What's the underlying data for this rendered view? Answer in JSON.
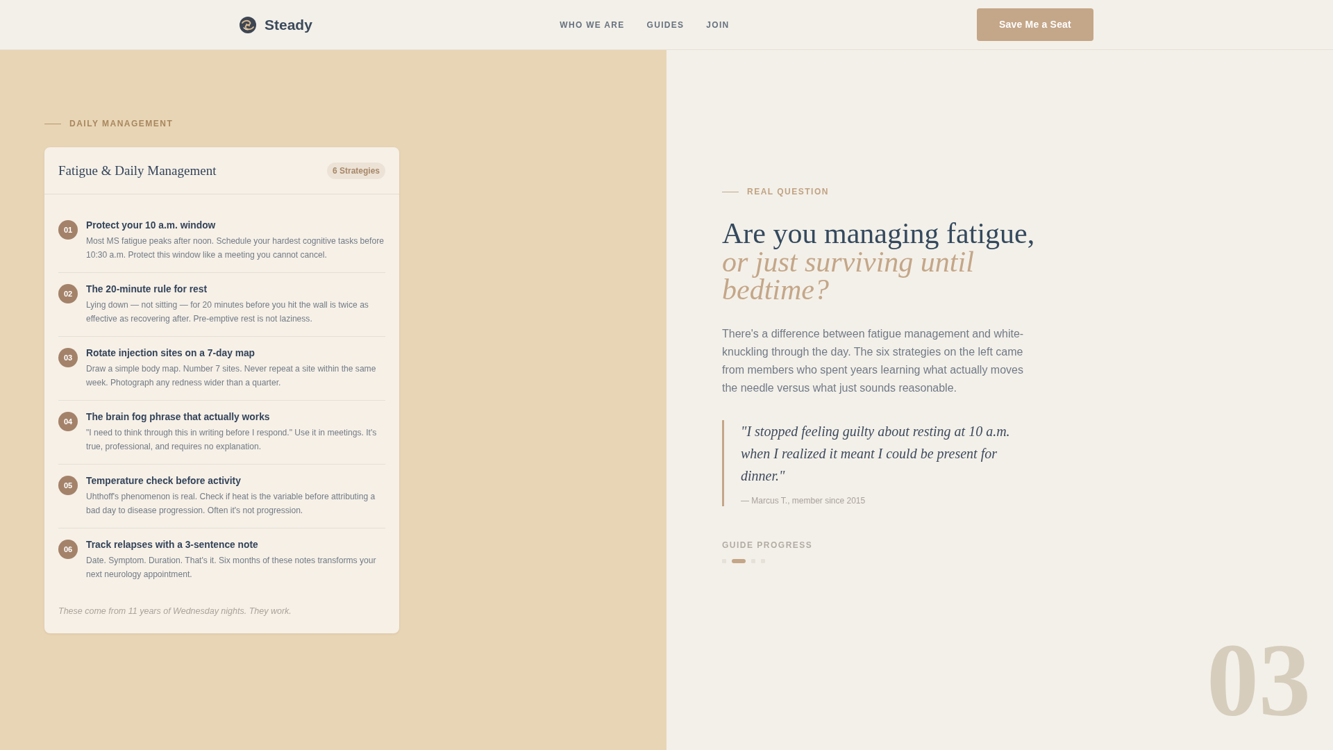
{
  "header": {
    "brand": "Steady",
    "nav": [
      "WHO WE ARE",
      "GUIDES",
      "JOIN"
    ],
    "cta": "Save Me a Seat"
  },
  "left": {
    "eyebrow": "DAILY MANAGEMENT",
    "card": {
      "title": "Fatigue & Daily Management",
      "badge": "6 Strategies",
      "items": [
        {
          "number": "01",
          "title": "Protect your 10 a.m. window",
          "description": "Most MS fatigue peaks after noon. Schedule your hardest cognitive tasks before 10:30 a.m. Protect this window like a meeting you cannot cancel."
        },
        {
          "number": "02",
          "title": "The 20-minute rule for rest",
          "description": "Lying down — not sitting — for 20 minutes before you hit the wall is twice as effective as recovering after. Pre-emptive rest is not laziness."
        },
        {
          "number": "03",
          "title": "Rotate injection sites on a 7-day map",
          "description": "Draw a simple body map. Number 7 sites. Never repeat a site within the same week. Photograph any redness wider than a quarter."
        },
        {
          "number": "04",
          "title": "The brain fog phrase that actually works",
          "description": "\"I need to think through this in writing before I respond.\" Use it in meetings. It's true, professional, and requires no explanation."
        },
        {
          "number": "05",
          "title": "Temperature check before activity",
          "description": "Uhthoff's phenomenon is real. Check if heat is the variable before attributing a bad day to disease progression. Often it's not progression."
        },
        {
          "number": "06",
          "title": "Track relapses with a 3-sentence note",
          "description": "Date. Symptom. Duration. That's it. Six months of these notes transforms your next neurology appointment."
        }
      ],
      "footer": "These come from 11 years of Wednesday nights. They work."
    }
  },
  "right": {
    "eyebrow": "REAL QUESTION",
    "headline": "Are you managing fatigue, *or just surviving until bedtime?*",
    "body": "There's a difference between fatigue management and white-knuckling through the day. The six strategies on the left came from members who spent years learning what actually moves the needle versus what just sounds reasonable.",
    "quote": {
      "text": "\"I stopped feeling guilty about resting at 10 a.m. when I realized it meant I could be present for dinner.\"",
      "attribution": "— Marcus T., member since 2015"
    },
    "progress": {
      "label": "GUIDE PROGRESS",
      "steps": [
        {
          "selected": false
        },
        {
          "selected": true
        },
        {
          "selected": false
        },
        {
          "selected": false
        }
      ]
    },
    "section_number": "03"
  }
}
